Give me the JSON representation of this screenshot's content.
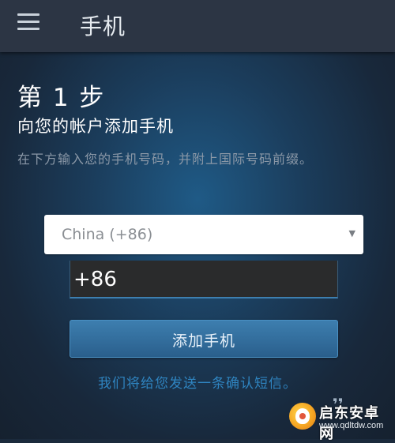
{
  "header": {
    "menu_icon": "hamburger-menu-icon",
    "title": "手机"
  },
  "step": {
    "title": "第 1 步",
    "subtitle": "向您的帐户添加手机",
    "description": "在下方输入您的手机号码，并附上国际号码前缀。"
  },
  "form": {
    "country_select": {
      "selected": "China (+86)",
      "caret": "▼"
    },
    "phone_input": {
      "value": "+86"
    },
    "add_button_label": "添加手机",
    "sms_note": "我们将给您发送一条确认短信。"
  },
  "misc": {
    "quote_glyph": "❜❜"
  },
  "watermark": {
    "name": "启东安卓网",
    "url": "www.qdltdw.com"
  },
  "colors": {
    "topbar": "#2c3544",
    "accent_blue": "#2f84c0",
    "button": "#3d7eaf"
  }
}
